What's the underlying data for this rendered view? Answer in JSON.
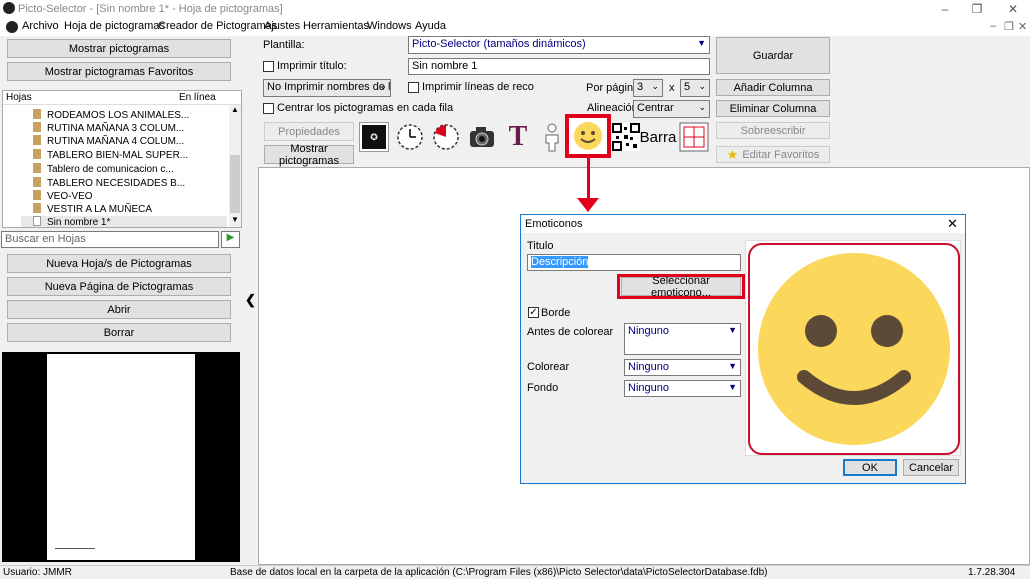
{
  "window": {
    "title": "Picto-Selector - [Sin nombre 1* - Hoja de pictogramas]"
  },
  "menu": [
    "Archivo",
    "Hoja de pictogramas",
    "Creador de Pictogramas",
    "Ajustes",
    "Herramientas",
    "Windows",
    "Ayuda"
  ],
  "left": {
    "show_btn": "Mostrar pictogramas",
    "show_fav_btn": "Mostrar pictogramas Favoritos",
    "tree_header": {
      "col1": "Hojas",
      "col2": "En línea"
    },
    "sheets": [
      "RODEAMOS LOS ANIMALES...",
      "RUTINA MAÑANA 3 COLUM...",
      "RUTINA MAÑANA 4 COLUM...",
      "TABLERO BIEN-MAL SUPER...",
      "Tablero de comunicacion c...",
      "TABLERO NECESIDADES B...",
      "VEO-VEO",
      "VESTIR A LA MUÑECA",
      "Sin nombre 1*"
    ],
    "search_placeholder": "Buscar en Hojas",
    "new_sheet_btn": "Nueva Hoja/s de Pictogramas",
    "new_page_btn": "Nueva Página de Pictogramas",
    "open_btn": "Abrir",
    "delete_btn": "Borrar"
  },
  "top": {
    "template_label": "Plantilla:",
    "template_value": "Picto-Selector (tamaños dinámicos)",
    "print_title_label": "Imprimir título:",
    "title_value": "Sin nombre 1",
    "names_select": "No Imprimir nombres de lo",
    "print_lines_label": "Imprimir líneas de reco",
    "per_page_label": "Por página",
    "per_page_rows": "3",
    "per_page_x": "x",
    "per_page_cols": "5",
    "center_label": "Centrar los pictogramas en cada fila",
    "align_label": "Alineación",
    "align_value": "Centrar",
    "properties_btn": "Propiedades",
    "show_picto_btn": "Mostrar pictogramas",
    "bar_text": "Barra",
    "save_btn": "Guardar",
    "add_col_btn": "Añadir Columna",
    "del_col_btn": "Eliminar Columna",
    "overwrite_btn": "Sobreescribir",
    "edit_fav_btn": "Editar Favoritos"
  },
  "dialog": {
    "title": "Emoticonos",
    "titulo_label": "Titulo",
    "titulo_value": "Descripción",
    "select_btn": "Seleccionar emoticono...",
    "border_label": "Borde",
    "before_color_label": "Antes de colorear",
    "before_color_value": "Ninguno",
    "color_label": "Colorear",
    "color_value": "Ninguno",
    "bg_label": "Fondo",
    "bg_value": "Ninguno",
    "ok_btn": "OK",
    "cancel_btn": "Cancelar"
  },
  "status": {
    "user": "Usuario: JMMR",
    "db": "Base de datos local en la carpeta de la aplicación (C:\\Program Files (x86)\\Picto Selector\\data\\PictoSelectorDatabase.fdb)",
    "version": "1.7.28.304"
  },
  "colors": {
    "accent": "#1979ca",
    "highlight": "#e0001b",
    "smiley": "#fbd75b",
    "smiley_features": "#5c4a36"
  }
}
